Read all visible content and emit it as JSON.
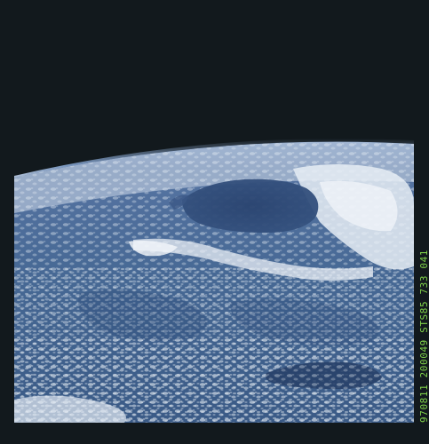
{
  "photo": {
    "imprint": "970811 200049 STS85    733  041",
    "colors": {
      "space": "#12191d",
      "ocean": "#3d5f8e",
      "ocean_dark": "#2c4a77",
      "clouds": "#dfe6ee",
      "limb_glow": "#7fa4d8",
      "imprint_text": "#7fd24a"
    }
  }
}
